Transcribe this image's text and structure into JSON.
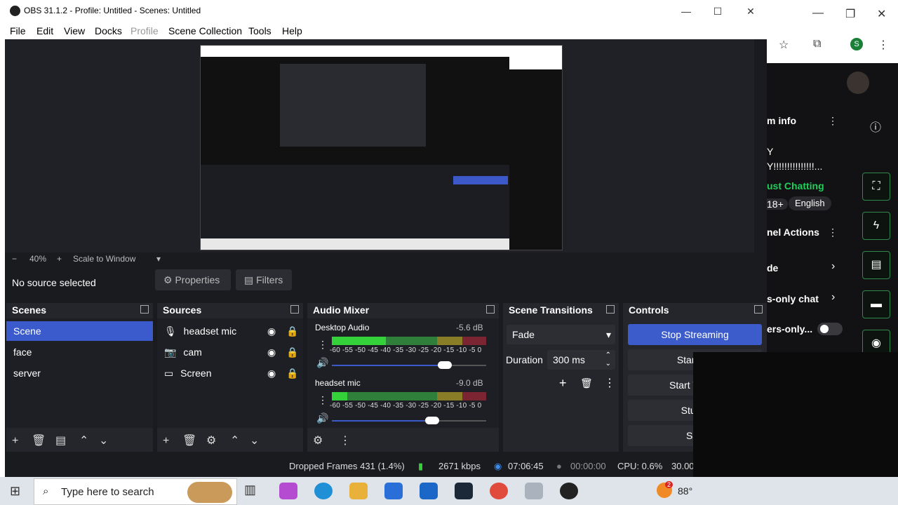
{
  "window": {
    "title": "OBS 31.1.2 - Profile: Untitled - Scenes: Untitled",
    "controls": [
      "—",
      "☐",
      "✕"
    ],
    "browser_controls": [
      "—",
      "❐",
      "✕"
    ]
  },
  "menu": [
    "File",
    "Edit",
    "View",
    "Docks",
    "Profile",
    "Scene Collection",
    "Tools",
    "Help"
  ],
  "zoom": {
    "minus": "−",
    "value": "40%",
    "plus": "+",
    "mode": "Scale to Window"
  },
  "source_bar": {
    "status": "No source selected",
    "properties": "Properties",
    "filters": "Filters"
  },
  "scenes": {
    "title": "Scenes",
    "items": [
      "Scene",
      "face",
      "server"
    ]
  },
  "sources": {
    "title": "Sources",
    "items": [
      "headset mic",
      "cam",
      "Screen"
    ]
  },
  "audio": {
    "title": "Audio Mixer",
    "channels": [
      {
        "name": "Desktop Audio",
        "db": "-5.6 dB",
        "level": 0.35,
        "volume": 0.73
      },
      {
        "name": "headset mic",
        "db": "-9.0 dB",
        "level": 0.1,
        "volume": 0.65
      }
    ],
    "scale": "-60 -55 -50 -45 -40 -35 -30 -25 -20 -15 -10 -5 0"
  },
  "transitions": {
    "title": "Scene Transitions",
    "type": "Fade",
    "duration_label": "Duration",
    "duration_value": "300 ms"
  },
  "controls": {
    "title": "Controls",
    "buttons": [
      "Stop Streaming",
      "Start Re",
      "Start Virtual",
      "Studio",
      "Sett"
    ]
  },
  "status": {
    "dropped": "Dropped Frames 431 (1.4%)",
    "bitrate": "2671 kbps",
    "live_time": "07:06:45",
    "rec_time": "00:00:00",
    "cpu": "CPU: 0.6%",
    "fps": "30.00"
  },
  "chat": {
    "rows": [
      "m info",
      "Y",
      "Y!!!!!!!!!!!!!!!...",
      "ust Chatting",
      "18+",
      "English",
      "nel Actions",
      "de",
      "s-only chat",
      "ers-only..."
    ],
    "accent": "#1fcf5a"
  },
  "taskbar": {
    "search_placeholder": "Type here to search",
    "weather": "88°",
    "badge": "2"
  }
}
